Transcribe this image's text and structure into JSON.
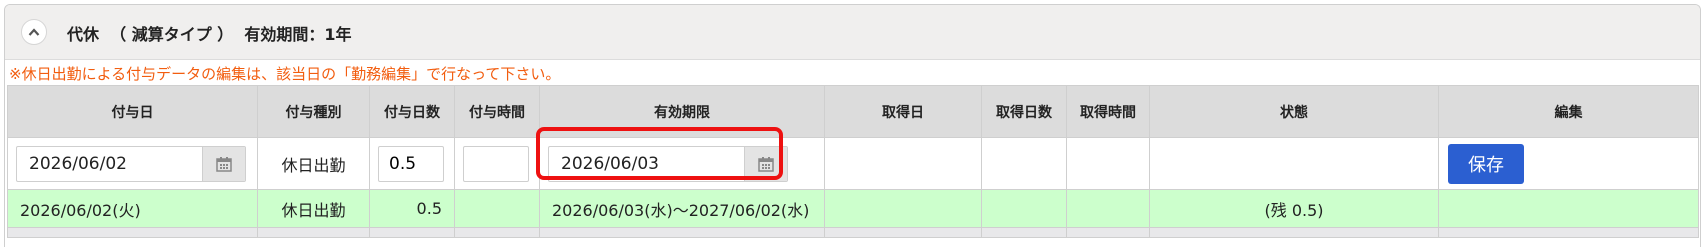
{
  "header": {
    "title": "代休  （ 減算タイプ ）  有効期間：1年"
  },
  "notice": "※休日出勤による付与データの編集は、該当日の「勤務編集」で行なって下さい。",
  "columns": [
    "付与日",
    "付与種別",
    "付与日数",
    "付与時間",
    "有効期限",
    "取得日",
    "取得日数",
    "取得時間",
    "状態",
    "編集"
  ],
  "edit_row": {
    "grant_date": "2026/06/02",
    "grant_type": "休日出勤",
    "grant_days": "0.5",
    "grant_time": "",
    "expiry_date": "2026/06/03",
    "save_label": "保存"
  },
  "rows": [
    {
      "grant_date": "2026/06/02(火)",
      "grant_type": "休日出勤",
      "grant_days": "0.5",
      "grant_time": "",
      "validity": "2026/06/03(水)〜2027/06/02(水)",
      "taken_date": "",
      "taken_days": "",
      "taken_time": "",
      "status": "(残 0.5)",
      "edit": ""
    }
  ]
}
